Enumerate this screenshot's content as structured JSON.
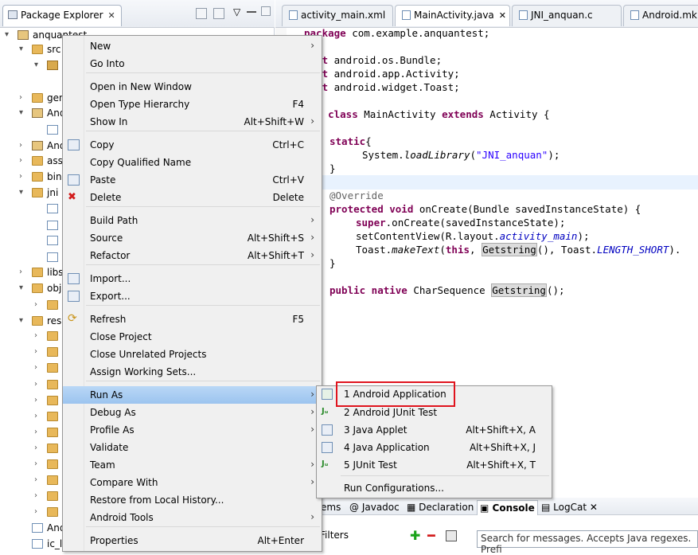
{
  "package_explorer": {
    "title": "Package Explorer",
    "close": "✕",
    "tree": [
      {
        "label": "anquantest",
        "indent": 0,
        "icon": "project-icon"
      },
      {
        "label": "src",
        "indent": 1,
        "icon": "folder-icon"
      },
      {
        "label": "",
        "indent": 2,
        "icon": "package-icon"
      },
      {
        "label": "",
        "indent": 3,
        "icon": "file-icon"
      },
      {
        "label": "gen",
        "indent": 1,
        "icon": "folder-icon"
      },
      {
        "label": "And",
        "indent": 1,
        "icon": "library-icon"
      },
      {
        "label": "",
        "indent": 2,
        "icon": "file-icon"
      },
      {
        "label": "And",
        "indent": 1,
        "icon": "library-icon"
      },
      {
        "label": "ass",
        "indent": 1,
        "icon": "folder-icon"
      },
      {
        "label": "bin",
        "indent": 1,
        "icon": "folder-icon"
      },
      {
        "label": "jni",
        "indent": 1,
        "icon": "folder-icon"
      },
      {
        "label": "",
        "indent": 2,
        "icon": "file-icon"
      },
      {
        "label": "",
        "indent": 2,
        "icon": "file-icon"
      },
      {
        "label": "",
        "indent": 2,
        "icon": "file-icon"
      },
      {
        "label": "",
        "indent": 2,
        "icon": "file-icon"
      },
      {
        "label": "libs",
        "indent": 1,
        "icon": "folder-icon"
      },
      {
        "label": "obj",
        "indent": 1,
        "icon": "folder-icon"
      },
      {
        "label": "",
        "indent": 2,
        "icon": "folder-icon"
      },
      {
        "label": "res",
        "indent": 1,
        "icon": "folder-icon"
      },
      {
        "label": "",
        "indent": 2,
        "icon": "folder-icon"
      },
      {
        "label": "",
        "indent": 2,
        "icon": "folder-icon"
      },
      {
        "label": "",
        "indent": 2,
        "icon": "folder-icon"
      },
      {
        "label": "",
        "indent": 2,
        "icon": "folder-icon"
      },
      {
        "label": "",
        "indent": 2,
        "icon": "folder-icon"
      },
      {
        "label": "",
        "indent": 2,
        "icon": "folder-icon"
      },
      {
        "label": "",
        "indent": 2,
        "icon": "folder-icon"
      },
      {
        "label": "",
        "indent": 2,
        "icon": "folder-icon"
      },
      {
        "label": "",
        "indent": 2,
        "icon": "folder-icon"
      },
      {
        "label": "",
        "indent": 2,
        "icon": "folder-icon"
      },
      {
        "label": "",
        "indent": 2,
        "icon": "folder-icon"
      },
      {
        "label": "",
        "indent": 2,
        "icon": "folder-icon"
      },
      {
        "label": "And",
        "indent": 1,
        "icon": "file-icon"
      },
      {
        "label": "ic_l",
        "indent": 1,
        "icon": "file-icon"
      }
    ]
  },
  "editor": {
    "tabs": [
      {
        "label": "activity_main.xml",
        "active": false
      },
      {
        "label": "MainActivity.java",
        "active": true
      },
      {
        "label": "JNI_anquan.c",
        "active": false
      },
      {
        "label": "Android.mk",
        "active": false
      }
    ],
    "code": {
      "l1a": "package",
      "l1b": " com.example.anquantest;",
      "l2a": "port",
      "l2b": " android.os.Bundle;",
      "l3a": "port",
      "l3b": " android.app.Activity;",
      "l4a": "port",
      "l4b": " android.widget.Toast;",
      "l5a": "lic class",
      "l5b": " MainActivity ",
      "l5c": "extends",
      "l5d": " Activity {",
      "l6a": "static",
      "l6b": "{",
      "l7a": "System.",
      "l7b": "loadLibrary",
      "l7c": "(",
      "l7d": "\"JNI_anquan\"",
      "l7e": ");",
      "l8": "}",
      "l9": "@Override",
      "l10a": "protected void",
      "l10b": " onCreate(Bundle savedInstanceState) {",
      "l11a": "super",
      "l11b": ".onCreate(savedInstanceState);",
      "l12a": "setContentView(R.layout.",
      "l12b": "activity_main",
      "l12c": ");",
      "l13a": "Toast.",
      "l13b": "makeText",
      "l13c": "(",
      "l13d": "this",
      "l13e": ", ",
      "l13f": "Getstring",
      "l13g": "(), Toast.",
      "l13h": "LENGTH_SHORT",
      "l13i": ").",
      "l14": "}",
      "l15a": "public native",
      "l15b": " CharSequence ",
      "l15c": "Getstring",
      "l15d": "();"
    }
  },
  "bottom_panel": {
    "tabs": [
      "ems",
      "Javadoc",
      "Declaration",
      "Console",
      "LogCat"
    ],
    "filters_label": "Filters",
    "search_placeholder": "Search for messages. Accepts Java regexes. Prefi"
  },
  "context_menu": {
    "items": [
      {
        "label": "New",
        "accel": "",
        "submenu": true
      },
      {
        "label": "Go Into",
        "accel": "",
        "submenu": false
      },
      {
        "label": "Open in New Window",
        "accel": "",
        "submenu": false
      },
      {
        "label": "Open Type Hierarchy",
        "accel": "F4",
        "submenu": false
      },
      {
        "label": "Show In",
        "accel": "Alt+Shift+W",
        "submenu": true
      },
      {
        "label": "Copy",
        "accel": "Ctrl+C",
        "submenu": false
      },
      {
        "label": "Copy Qualified Name",
        "accel": "",
        "submenu": false
      },
      {
        "label": "Paste",
        "accel": "Ctrl+V",
        "submenu": false
      },
      {
        "label": "Delete",
        "accel": "Delete",
        "submenu": false
      },
      {
        "label": "Build Path",
        "accel": "",
        "submenu": true
      },
      {
        "label": "Source",
        "accel": "Alt+Shift+S",
        "submenu": true
      },
      {
        "label": "Refactor",
        "accel": "Alt+Shift+T",
        "submenu": true
      },
      {
        "label": "Import...",
        "accel": "",
        "submenu": false
      },
      {
        "label": "Export...",
        "accel": "",
        "submenu": false
      },
      {
        "label": "Refresh",
        "accel": "F5",
        "submenu": false
      },
      {
        "label": "Close Project",
        "accel": "",
        "submenu": false
      },
      {
        "label": "Close Unrelated Projects",
        "accel": "",
        "submenu": false
      },
      {
        "label": "Assign Working Sets...",
        "accel": "",
        "submenu": false
      },
      {
        "label": "Run As",
        "accel": "",
        "submenu": true
      },
      {
        "label": "Debug As",
        "accel": "",
        "submenu": true
      },
      {
        "label": "Profile As",
        "accel": "",
        "submenu": true
      },
      {
        "label": "Validate",
        "accel": "",
        "submenu": false
      },
      {
        "label": "Team",
        "accel": "",
        "submenu": true
      },
      {
        "label": "Compare With",
        "accel": "",
        "submenu": true
      },
      {
        "label": "Restore from Local History...",
        "accel": "",
        "submenu": false
      },
      {
        "label": "Android Tools",
        "accel": "",
        "submenu": true
      },
      {
        "label": "Properties",
        "accel": "Alt+Enter",
        "submenu": false
      }
    ],
    "arrow": "›"
  },
  "run_as_submenu": {
    "items": [
      {
        "label": "1 Android Application",
        "accel": ""
      },
      {
        "label": "2 Android JUnit Test",
        "accel": ""
      },
      {
        "label": "3 Java Applet",
        "accel": "Alt+Shift+X, A"
      },
      {
        "label": "4 Java Application",
        "accel": "Alt+Shift+X, J"
      },
      {
        "label": "5 JUnit Test",
        "accel": "Alt+Shift+X, T"
      },
      {
        "label": "Run Configurations...",
        "accel": ""
      }
    ]
  },
  "colors": {
    "highlight_box": "#e0141e",
    "keyword": "#7f0055",
    "string": "#2a00ff",
    "selection": "#9cc4ef"
  }
}
